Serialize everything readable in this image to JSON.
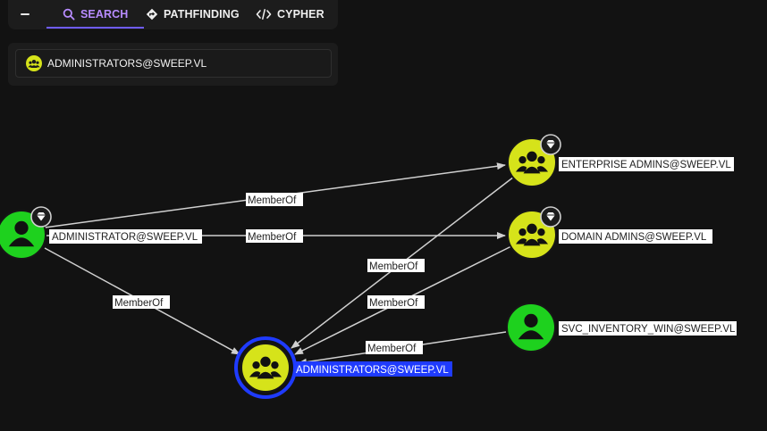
{
  "toolbar": {
    "tabs": [
      {
        "label": "SEARCH",
        "icon": "search-icon",
        "active": true
      },
      {
        "label": "PATHFINDING",
        "icon": "pathfinding-icon",
        "active": false
      },
      {
        "label": "CYPHER",
        "icon": "code-icon",
        "active": false
      }
    ]
  },
  "search": {
    "value": "ADMINISTRATORS@SWEEP.VL",
    "icon": "group-icon"
  },
  "graph": {
    "nodes": [
      {
        "id": "administrator",
        "label": "ADMINISTRATOR@SWEEP.VL",
        "type": "user",
        "color": "#1ed11e",
        "tier_zero": true
      },
      {
        "id": "enterprise_admins",
        "label": "ENTERPRISE ADMINS@SWEEP.VL",
        "type": "group",
        "color": "#d6e31a",
        "tier_zero": true
      },
      {
        "id": "domain_admins",
        "label": "DOMAIN ADMINS@SWEEP.VL",
        "type": "group",
        "color": "#d6e31a",
        "tier_zero": true
      },
      {
        "id": "svc_inventory",
        "label": "SVC_INVENTORY_WIN@SWEEP.VL",
        "type": "user",
        "color": "#1ed11e",
        "tier_zero": false
      },
      {
        "id": "administrators",
        "label": "ADMINISTRATORS@SWEEP.VL",
        "type": "group",
        "color": "#d6e31a",
        "tier_zero": false,
        "selected": true
      }
    ],
    "edges": [
      {
        "from": "administrator",
        "to": "enterprise_admins",
        "label": "MemberOf"
      },
      {
        "from": "administrator",
        "to": "domain_admins",
        "label": "MemberOf"
      },
      {
        "from": "administrator",
        "to": "administrators",
        "label": "MemberOf"
      },
      {
        "from": "enterprise_admins",
        "to": "administrators",
        "label": "MemberOf"
      },
      {
        "from": "domain_admins",
        "to": "administrators",
        "label": "MemberOf"
      },
      {
        "from": "svc_inventory",
        "to": "administrators",
        "label": "MemberOf"
      }
    ],
    "selection_color": "#1f3bff"
  }
}
